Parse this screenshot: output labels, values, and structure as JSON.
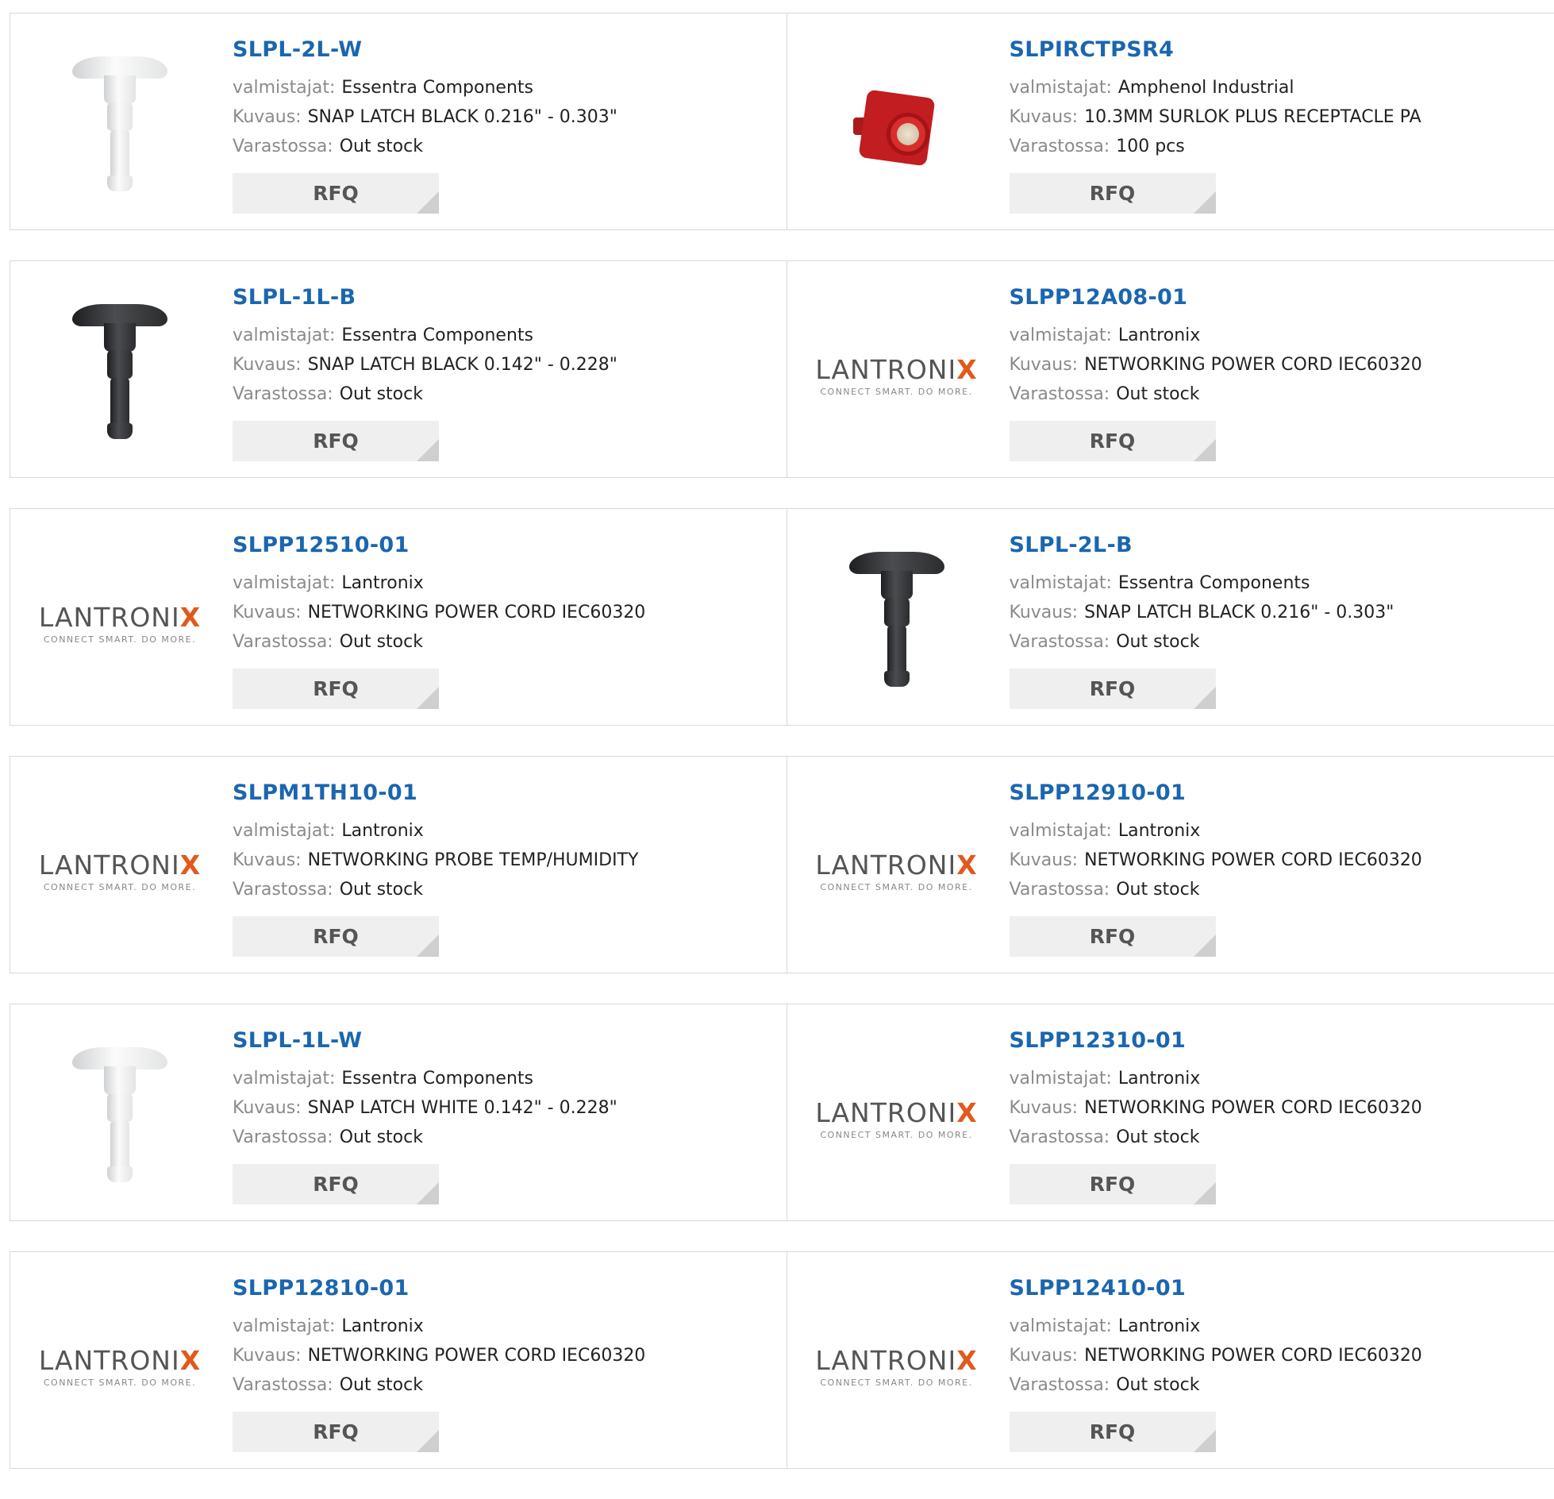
{
  "labels": {
    "manufacturer": "valmistajat:",
    "description": "Kuvaus:",
    "stock": "Varastossa:",
    "rfq": "RFQ"
  },
  "logos": {
    "lantronix_word": "LANTRONIX",
    "lantronix_tagline": "CONNECT SMART. DO MORE."
  },
  "products": [
    {
      "pn": "SLPL-2L-W",
      "manufacturer": "Essentra Components",
      "description": "SNAP LATCH BLACK 0.216\" - 0.303\"",
      "stock": "Out stock",
      "image": "latch-white"
    },
    {
      "pn": "SLPIRCTPSR4",
      "manufacturer": "Amphenol Industrial",
      "description": "10.3MM SURLOK PLUS RECEPTACLE PA",
      "stock": "100 pcs",
      "image": "receptacle-red"
    },
    {
      "pn": "SLPL-1L-B",
      "manufacturer": "Essentra Components",
      "description": "SNAP LATCH BLACK 0.142\" - 0.228\"",
      "stock": "Out stock",
      "image": "latch-black"
    },
    {
      "pn": "SLPP12A08-01",
      "manufacturer": "Lantronix",
      "description": "NETWORKING POWER CORD IEC60320",
      "stock": "Out stock",
      "image": "lantronix-logo"
    },
    {
      "pn": "SLPP12510-01",
      "manufacturer": "Lantronix",
      "description": "NETWORKING POWER CORD IEC60320",
      "stock": "Out stock",
      "image": "lantronix-logo"
    },
    {
      "pn": "SLPL-2L-B",
      "manufacturer": "Essentra Components",
      "description": "SNAP LATCH BLACK 0.216\" - 0.303\"",
      "stock": "Out stock",
      "image": "latch-black"
    },
    {
      "pn": "SLPM1TH10-01",
      "manufacturer": "Lantronix",
      "description": "NETWORKING PROBE TEMP/HUMIDITY",
      "stock": "Out stock",
      "image": "lantronix-logo"
    },
    {
      "pn": "SLPP12910-01",
      "manufacturer": "Lantronix",
      "description": "NETWORKING POWER CORD IEC60320",
      "stock": "Out stock",
      "image": "lantronix-logo"
    },
    {
      "pn": "SLPL-1L-W",
      "manufacturer": "Essentra Components",
      "description": "SNAP LATCH WHITE 0.142\" - 0.228\"",
      "stock": "Out stock",
      "image": "latch-white"
    },
    {
      "pn": "SLPP12310-01",
      "manufacturer": "Lantronix",
      "description": "NETWORKING POWER CORD IEC60320",
      "stock": "Out stock",
      "image": "lantronix-logo"
    },
    {
      "pn": "SLPP12810-01",
      "manufacturer": "Lantronix",
      "description": "NETWORKING POWER CORD IEC60320",
      "stock": "Out stock",
      "image": "lantronix-logo"
    },
    {
      "pn": "SLPP12410-01",
      "manufacturer": "Lantronix",
      "description": "NETWORKING POWER CORD IEC60320",
      "stock": "Out stock",
      "image": "lantronix-logo"
    }
  ]
}
